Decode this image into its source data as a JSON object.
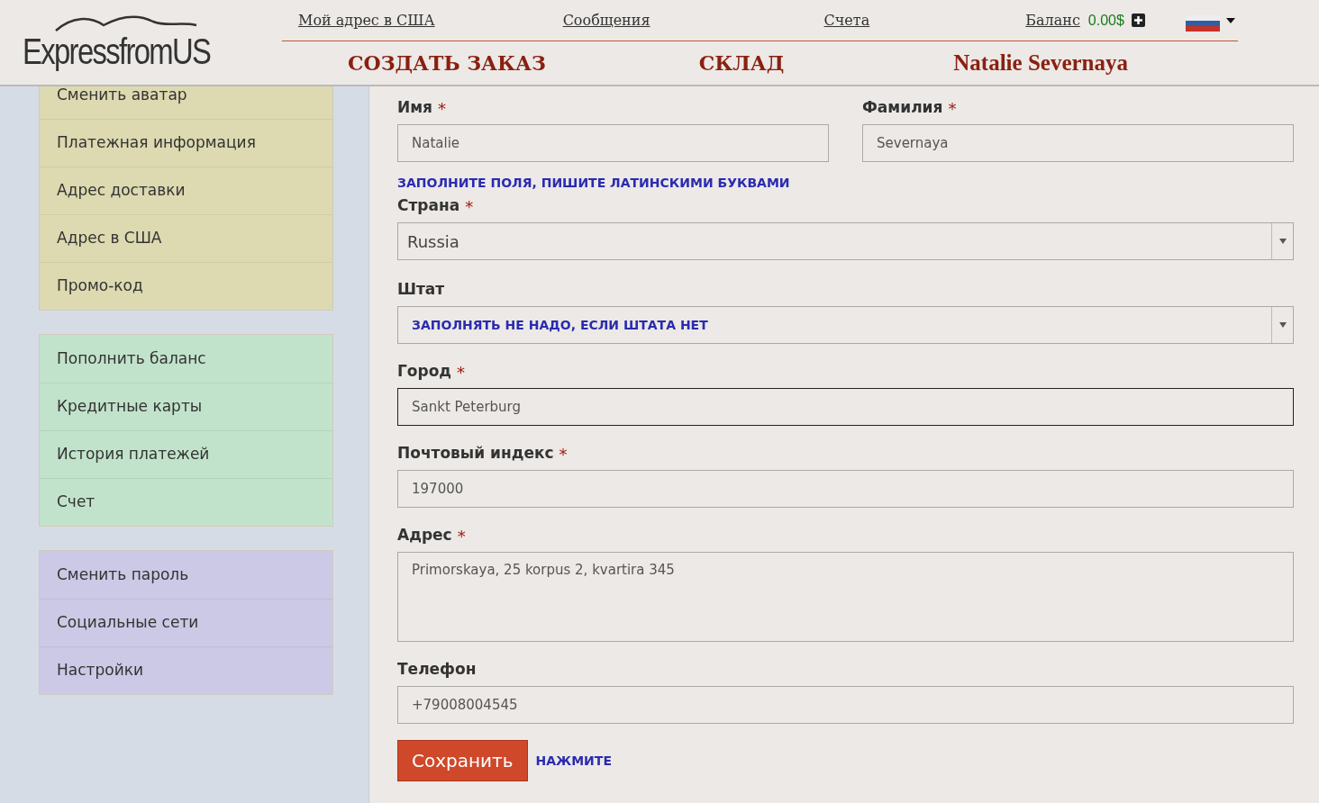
{
  "header": {
    "logo": "ExpressfromUS",
    "top_links": [
      "Мой адрес в США",
      "Сообщения",
      "Счета"
    ],
    "balance": {
      "label": "Баланс",
      "amount": "0.00$"
    },
    "main_links": [
      "СОЗДАТЬ ЗАКАЗ",
      "СКЛАД",
      "Natalie Severnaya"
    ]
  },
  "sidebar": {
    "groups": [
      {
        "color": "#ddd9b0",
        "items": [
          "Сменить аватар",
          "Платежная информация",
          "Адрес доставки",
          "Адрес в США",
          "Промо-код"
        ]
      },
      {
        "color": "#c2e3cb",
        "items": [
          "Пополнить баланс",
          "Кредитные карты",
          "История платежей",
          "Счет"
        ]
      },
      {
        "color": "#ccc9e6",
        "items": [
          "Сменить пароль",
          "Социальные сети",
          "Настройки"
        ]
      }
    ]
  },
  "form": {
    "name_row": [
      {
        "label": "Имя",
        "required_mark": "*",
        "value": "Natalie"
      },
      {
        "label": "Фамилия",
        "required_mark": "*",
        "value": "Severnaya"
      }
    ],
    "note": "ЗАПОЛНИТЕ ПОЛЯ, ПИШИТЕ ЛАТИНСКИМИ БУКВАМИ",
    "fields": [
      {
        "kind": "select",
        "label": "Страна",
        "required_mark": "*",
        "value": "Russia",
        "hint": false,
        "focused": false
      },
      {
        "kind": "select",
        "label": "Штат",
        "value": "ЗАПОЛНЯТЬ НЕ НАДО, ЕСЛИ ШТАТА НЕТ",
        "hint": true,
        "focused": false
      },
      {
        "kind": "text",
        "label": "Город",
        "required_mark": "*",
        "value": "Sankt Peterburg",
        "hint": false,
        "focused": true
      },
      {
        "kind": "text",
        "label": "Почтовый индекс",
        "required_mark": "*",
        "value": "197000",
        "hint": false,
        "focused": false
      },
      {
        "kind": "textarea",
        "label": "Адрес",
        "required_mark": "*",
        "value": "Primorskaya, 25 korpus 2, kvartira 345",
        "hint": false,
        "focused": false
      },
      {
        "kind": "text",
        "label": "Телефон",
        "value": "+79008004545",
        "hint": false,
        "focused": false
      }
    ],
    "save_button": "Сохранить",
    "save_hint": "НАЖМИТЕ"
  }
}
